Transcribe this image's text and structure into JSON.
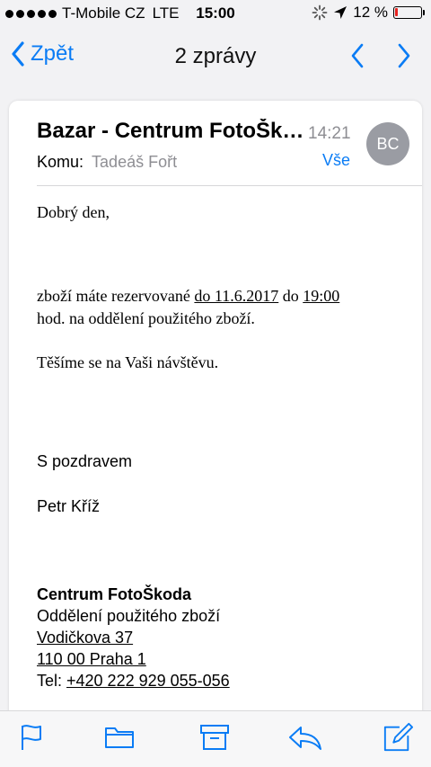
{
  "status_bar": {
    "carrier": "T-Mobile CZ",
    "network": "LTE",
    "time": "15:00",
    "battery_text": "12 %",
    "battery_level": 0.12,
    "battery_color": "#e8231f"
  },
  "nav": {
    "back_label": "Zpět",
    "title": "2 zprávy"
  },
  "message": {
    "subject": "Bazar - Centrum FotoŠkoda",
    "time": "14:21",
    "avatar_initials": "BC",
    "to_label": "Komu:",
    "to_name": "Tadeáš Fořt",
    "all_label": "Vše",
    "greeting": "Dobrý den,",
    "line1_a": "zboží máte rezervované ",
    "line1_date": "do 11.6.2017",
    "line1_b": " do ",
    "line1_time": "19:00",
    "line2": "hod. na oddělení použitého zboží.",
    "closing": "Těšíme se na Vaši návštěvu.",
    "regards": "S pozdravem",
    "signer": "Petr Kříž",
    "company": "Centrum FotoŠkoda",
    "department": "Oddělení použitého zboží",
    "street": "Vodičkova 37",
    "city": "110 00 Praha 1",
    "tel_label": "Tel: ",
    "tel": "+420 222 929 055-056"
  },
  "colors": {
    "accent": "#0a7cf5",
    "muted": "#8e8e93"
  },
  "toolbar": {
    "icons": [
      "flag-icon",
      "folder-icon",
      "archive-icon",
      "reply-icon",
      "compose-icon"
    ]
  }
}
